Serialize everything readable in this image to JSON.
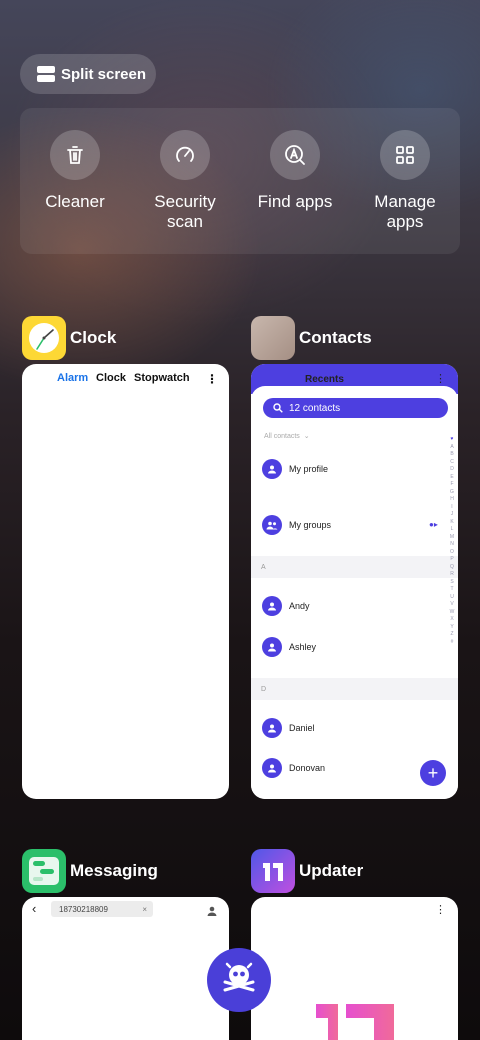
{
  "split_screen": {
    "label": "Split screen",
    "icon": "split-screen-icon"
  },
  "quick_actions": [
    {
      "label": "Cleaner",
      "icon": "trash-icon"
    },
    {
      "label": "Security\nscan",
      "icon": "security-gauge-icon"
    },
    {
      "label": "Find apps",
      "icon": "find-apps-icon"
    },
    {
      "label": "Manage\napps",
      "icon": "grid-apps-icon"
    }
  ],
  "apps": [
    {
      "name": "Clock",
      "tabs": [
        "Alarm",
        "Clock",
        "Stopwatch"
      ],
      "active_tab": "Alarm",
      "accent": "#1a73e8"
    },
    {
      "name": "Contacts",
      "tab_label": "Recents",
      "search_label": "12 contacts",
      "filter_label": "All contacts",
      "items": [
        "My profile",
        "My groups"
      ],
      "sections": [
        {
          "letter": "A",
          "contacts": [
            "Andy",
            "Ashley"
          ]
        },
        {
          "letter": "D",
          "contacts": [
            "Daniel",
            "Donovan"
          ]
        }
      ],
      "alphabet": [
        "♥",
        "A",
        "B",
        "C",
        "D",
        "E",
        "F",
        "G",
        "H",
        "I",
        "J",
        "K",
        "L",
        "M",
        "N",
        "O",
        "P",
        "Q",
        "R",
        "S",
        "T",
        "U",
        "V",
        "W",
        "X",
        "Y",
        "Z",
        "#"
      ],
      "accent": "#4d3fe0"
    },
    {
      "name": "Messaging",
      "recipient": "18730218809"
    },
    {
      "name": "Updater"
    }
  ],
  "colors": {
    "contacts_purple": "#4d3fe0",
    "clock_yellow": "#fdd835",
    "messaging_green": "#2bbf6a",
    "updater_pink": "#e64fcf"
  }
}
